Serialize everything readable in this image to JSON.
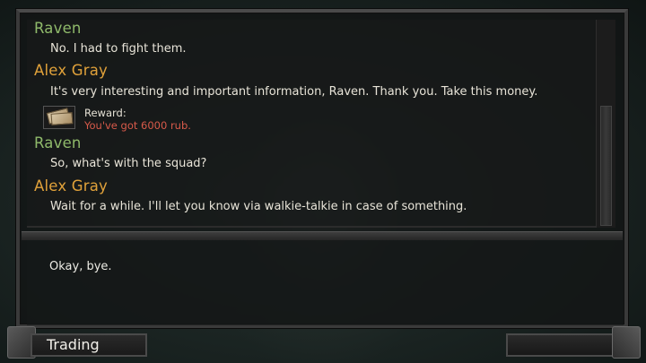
{
  "dialog": {
    "history": [
      {
        "speaker": "Raven",
        "text": "No. I had to fight them."
      },
      {
        "speaker": "Alex Gray",
        "text": "It's very interesting and important information, Raven. Thank you. Take this money."
      },
      {
        "speaker": "Raven",
        "text": "So, what's with the squad?"
      },
      {
        "speaker": "Alex Gray",
        "text": "Wait for a while. I'll let you know via walkie-talkie in case of something."
      }
    ],
    "reward": {
      "label": "Reward:",
      "value": "You've got 6000 rub."
    },
    "answers": [
      "Okay, bye."
    ]
  },
  "bottom_bar": {
    "trading_label": "Trading"
  },
  "colors": {
    "raven": "#8fb96a",
    "alex": "#e0a13a",
    "reward_value": "#d85a4a"
  },
  "icons": {
    "reward": "money-icon"
  }
}
